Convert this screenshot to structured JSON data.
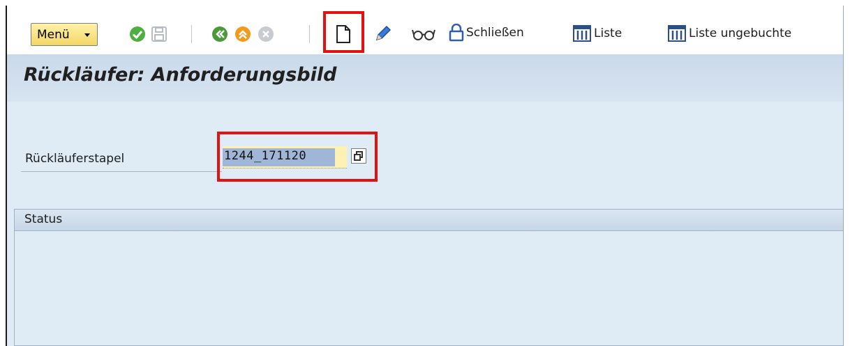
{
  "toolbar": {
    "menu_label": "Menü",
    "icons": [
      "check-icon",
      "save-icon",
      "back-icon",
      "exit-icon",
      "cancel-icon",
      "new-document-icon",
      "edit-pencil-icon",
      "display-glasses-icon",
      "lock-icon",
      "list-icon"
    ],
    "close_label": "Schließen",
    "list_label": "Liste",
    "list_unposted_label": "Liste ungebuchte"
  },
  "header": {
    "title": "Rückläufer: Anforderungsbild"
  },
  "form": {
    "batch_label": "Rückläuferstapel",
    "batch_value": "1244_171120"
  },
  "status": {
    "title": "Status"
  },
  "colors": {
    "highlight_border": "#e21212",
    "menu_button": "#f4d664",
    "input_background": "#fdf2b4",
    "title_background": "#cad9ea"
  }
}
